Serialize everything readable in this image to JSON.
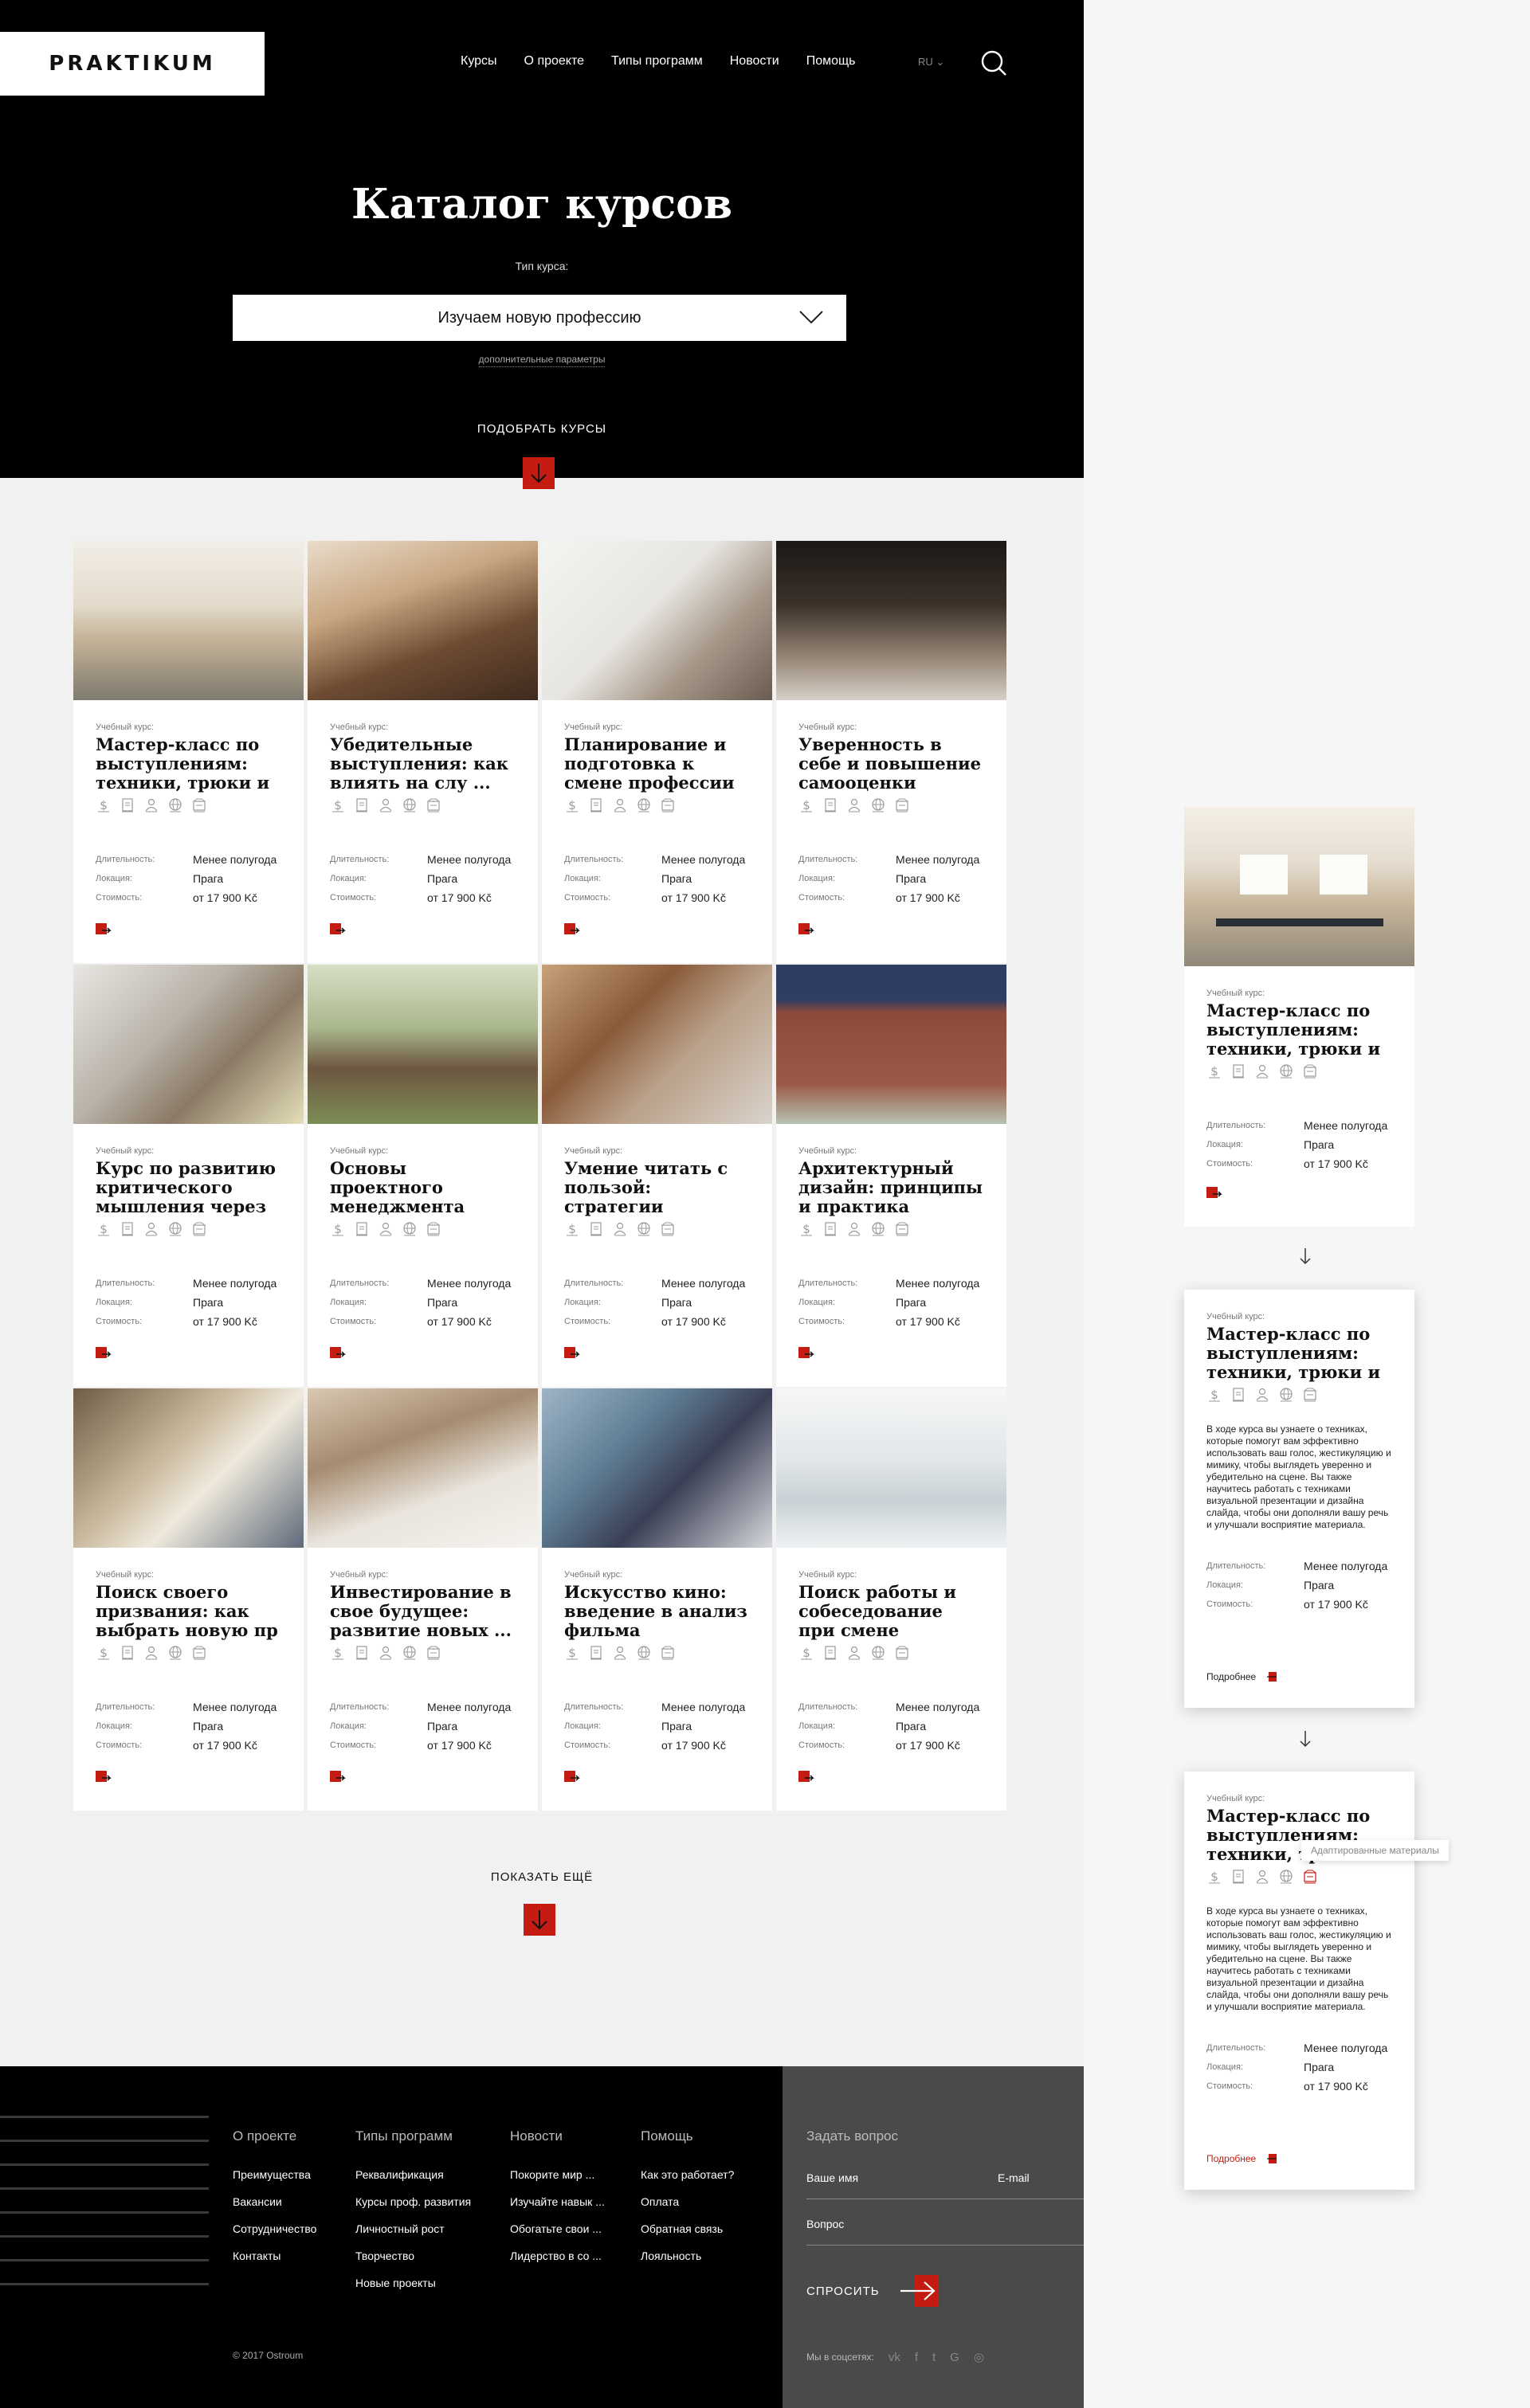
{
  "header": {
    "logo": "PRAKTIKUM",
    "nav": [
      "Курсы",
      "О проекте",
      "Типы программ",
      "Новости",
      "Помощь"
    ],
    "lang": "RU",
    "title": "Каталог курсов",
    "type_label": "Тип курса:",
    "type_value": "Изучаем новую профессию",
    "more_params": "дополнительные параметры",
    "pick_button": "ПОДОБРАТЬ КУРСЫ"
  },
  "card_labels": {
    "kicker": "Учебный курс:",
    "duration_key": "Длительность:",
    "location_key": "Локация:",
    "price_key": "Стоимость:"
  },
  "icon_names": [
    "dollar-icon",
    "document-icon",
    "person-icon",
    "globe-icon",
    "materials-icon"
  ],
  "courses": [
    {
      "title": "Мастер-класс по выступлениям: техники, трюки и ...",
      "duration": "Менее полугода",
      "location": "Прага",
      "price": "от 17 900 Kč",
      "img": "classroom"
    },
    {
      "title": "Убедительные выступления: как влиять на слу ...",
      "duration": "Менее полугода",
      "location": "Прага",
      "price": "от 17 900 Kč",
      "img": "lecture"
    },
    {
      "title": "Планирование и подготовка к смене профессии",
      "duration": "Менее полугода",
      "location": "Прага",
      "price": "от 17 900 Kč",
      "img": "laptop"
    },
    {
      "title": "Уверенность в себе и повышение самооценки",
      "duration": "Менее полугода",
      "location": "Прага",
      "price": "от 17 900 Kč",
      "img": "walking"
    },
    {
      "title": "Курс по развитию критического мышления через ...",
      "duration": "Менее полугода",
      "location": "Прага",
      "price": "от 17 900 Kč",
      "img": "students"
    },
    {
      "title": "Основы проектного менеджмента",
      "duration": "Менее полугода",
      "location": "Прага",
      "price": "от 17 900 Kč",
      "img": "park"
    },
    {
      "title": "Умение читать с пользой: стратегии активного чтения ...",
      "duration": "Менее полугода",
      "location": "Прага",
      "price": "от 17 900 Kč",
      "img": "library"
    },
    {
      "title": "Архитектурный дизайн: принципы и практика",
      "duration": "Менее полугода",
      "location": "Прага",
      "price": "от 17 900 Kč",
      "img": "building"
    },
    {
      "title": "Поиск своего призвания: как выбрать новую пр ...",
      "duration": "Менее полугода",
      "location": "Прага",
      "price": "от 17 900 Kč",
      "img": "shelves"
    },
    {
      "title": "Инвестирование в свое будущее: развитие новых ...",
      "duration": "Менее полугода",
      "location": "Прага",
      "price": "от 17 900 Kč",
      "img": "study"
    },
    {
      "title": "Искусство кино: введение в анализ фильма",
      "duration": "Менее полугода",
      "location": "Прага",
      "price": "от 17 900 Kč",
      "img": "bookman"
    },
    {
      "title": "Поиск работы и собеседование при смене профессии",
      "duration": "Менее полугода",
      "location": "Прага",
      "price": "от 17 900 Kč",
      "img": "corridor"
    }
  ],
  "show_more": "ПОКАЗАТЬ ЕЩЁ",
  "footer": {
    "columns": [
      {
        "heading": "О проекте",
        "items": [
          "Преимущества",
          "Вакансии",
          "Сотрудничество",
          "Контакты"
        ]
      },
      {
        "heading": "Типы программ",
        "items": [
          "Реквалификация",
          "Курсы проф. развития",
          "Личностный рост",
          "Творчество",
          "Новые проекты"
        ]
      },
      {
        "heading": "Новости",
        "items": [
          "Покорите мир ...",
          "Изучайте навык ...",
          "Обогатьте свои ...",
          "Лидерство в со ..."
        ]
      },
      {
        "heading": "Помощь",
        "items": [
          "Как это работает?",
          "Оплата",
          "Обратная связь",
          "Лояльность"
        ]
      }
    ],
    "copyright": "© 2017 Ostroum",
    "ask": {
      "heading": "Задать вопрос",
      "name_placeholder": "Ваше имя",
      "email_placeholder": "E-mail",
      "question_placeholder": "Вопрос",
      "button": "СПРОСИТЬ",
      "social_label": "Мы в соцсетях:",
      "social": [
        "vk",
        "f",
        "t",
        "G",
        "◎"
      ]
    }
  },
  "states": {
    "title": "Мастер-класс по выступлениям: техники, трюки и ...",
    "title_short": "Мастер-класс по выступлениям: техники,",
    "description": "В ходе курса вы узнаете о техниках, которые помогут вам эффективно использовать ваш голос, жестикуляцию и мимику, чтобы выглядеть уверенно и убедительно на сцене. Вы также научитесь работать с техниками визуальной презентации и дизайна слайда, чтобы они дополняли вашу речь и улучшали восприятие материала.",
    "more_link": "Подробнее",
    "tooltip": "Адаптированные материалы",
    "duration": "Менее полугода",
    "location": "Прага",
    "price": "от 17 900 Kč"
  },
  "colors": {
    "accent": "#c41c12",
    "dark": "#000000",
    "footer_panel": "#4a4a4a"
  }
}
